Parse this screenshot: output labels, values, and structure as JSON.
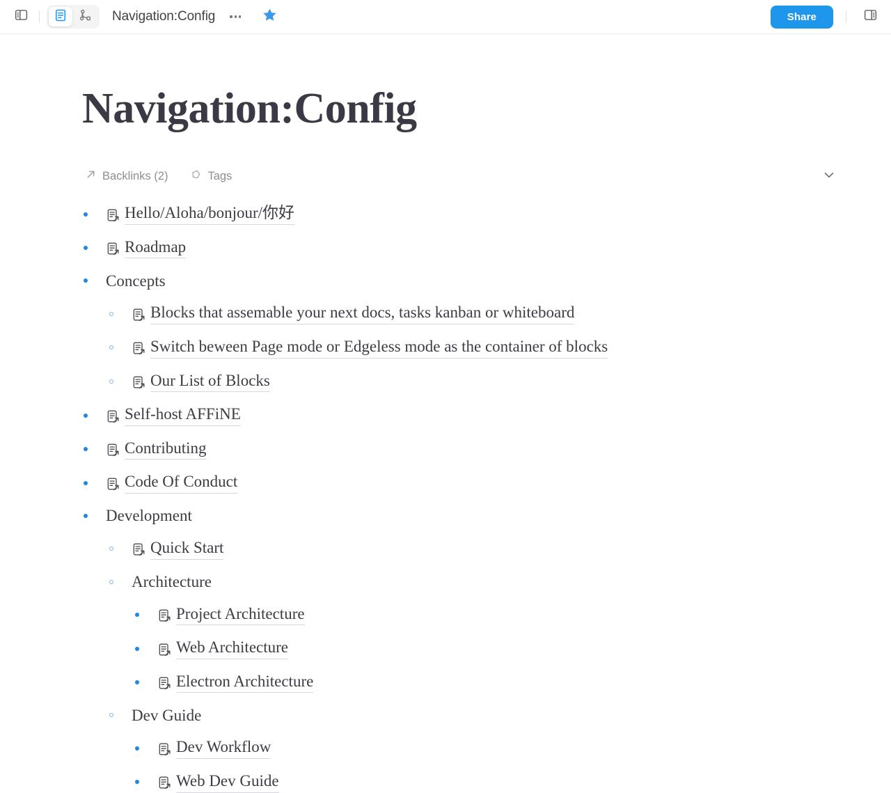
{
  "header": {
    "left_sidebar_toggle": "left-panel-icon",
    "mode_page": "page-mode-icon",
    "mode_edgeless": "edgeless-mode-icon",
    "breadcrumb_title": "Navigation:Config",
    "more_menu": "more-options-icon",
    "favorite": "star-icon",
    "share_label": "Share",
    "right_sidebar_toggle": "right-panel-icon",
    "accent_color": "#1e96eb"
  },
  "doc": {
    "title": "Navigation:Config",
    "backlinks_label": "Backlinks (2)",
    "tags_label": "Tags",
    "collapse_icon": "chevron-down-icon"
  },
  "outline": [
    {
      "level": 1,
      "bullet": "solid",
      "type": "link",
      "text": "Hello/Aloha/bonjour/你好"
    },
    {
      "level": 1,
      "bullet": "solid",
      "type": "link",
      "text": "Roadmap"
    },
    {
      "level": 1,
      "bullet": "solid",
      "type": "plain",
      "text": "Concepts"
    },
    {
      "level": 2,
      "bullet": "hollow",
      "type": "link",
      "text": "Blocks that assemable your next docs, tasks kanban or whiteboard"
    },
    {
      "level": 2,
      "bullet": "hollow",
      "type": "link",
      "text": "Switch beween Page mode or Edgeless mode as the container of blocks"
    },
    {
      "level": 2,
      "bullet": "hollow",
      "type": "link",
      "text": "Our List of Blocks"
    },
    {
      "level": 1,
      "bullet": "solid",
      "type": "link",
      "text": "Self-host AFFiNE"
    },
    {
      "level": 1,
      "bullet": "solid",
      "type": "link",
      "text": "Contributing"
    },
    {
      "level": 1,
      "bullet": "solid",
      "type": "link",
      "text": "Code Of Conduct"
    },
    {
      "level": 1,
      "bullet": "solid",
      "type": "plain",
      "text": "Development"
    },
    {
      "level": 2,
      "bullet": "hollow",
      "type": "link",
      "text": "Quick Start"
    },
    {
      "level": 2,
      "bullet": "hollow",
      "type": "plain",
      "text": "Architecture"
    },
    {
      "level": 3,
      "bullet": "solid",
      "type": "link",
      "text": "Project Architecture"
    },
    {
      "level": 3,
      "bullet": "solid",
      "type": "link",
      "text": "Web Architecture"
    },
    {
      "level": 3,
      "bullet": "solid",
      "type": "link",
      "text": "Electron Architecture"
    },
    {
      "level": 2,
      "bullet": "hollow",
      "type": "plain",
      "text": "Dev Guide"
    },
    {
      "level": 3,
      "bullet": "solid",
      "type": "link",
      "text": "Dev Workflow"
    },
    {
      "level": 3,
      "bullet": "solid",
      "type": "link",
      "text": "Web Dev Guide"
    }
  ]
}
